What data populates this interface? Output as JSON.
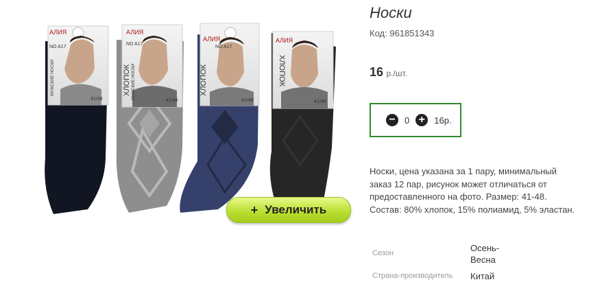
{
  "product": {
    "title": "Носки",
    "code_label": "Код:",
    "code_value": "961851343",
    "price_value": "16",
    "price_unit": "р./шт.",
    "quantity": "0",
    "quantity_total": "16р.",
    "description": "Носки, цена указана за 1 пару, минимальный заказ 12 пар, рисунок может отличаться от предоставленного на фото. Размер: 41-48. Состав: 80% хлопок, 15% полиамид, 5% эластан.",
    "zoom_label": "Увеличить",
    "zoom_icon": "+",
    "decrement_icon": "minus-circle-icon",
    "increment_icon": "plus-circle-icon",
    "attributes": [
      {
        "label": "Сезон",
        "value": "Осень-Весна"
      },
      {
        "label": "Страна-производитель",
        "value": "Китай"
      }
    ]
  },
  "packaging": {
    "brand": "АЛИЯ",
    "model": "NO A17",
    "material": "ХЛОПОК",
    "type": "МУЖСКИЕ НОСКИ",
    "size": "41/48"
  },
  "colors": {
    "qty_border": "#2e8b2e",
    "zoom_button": "#b9de2e",
    "sock_colors": [
      "#121623",
      "#8e8e8e",
      "#35416a",
      "#262626"
    ]
  }
}
